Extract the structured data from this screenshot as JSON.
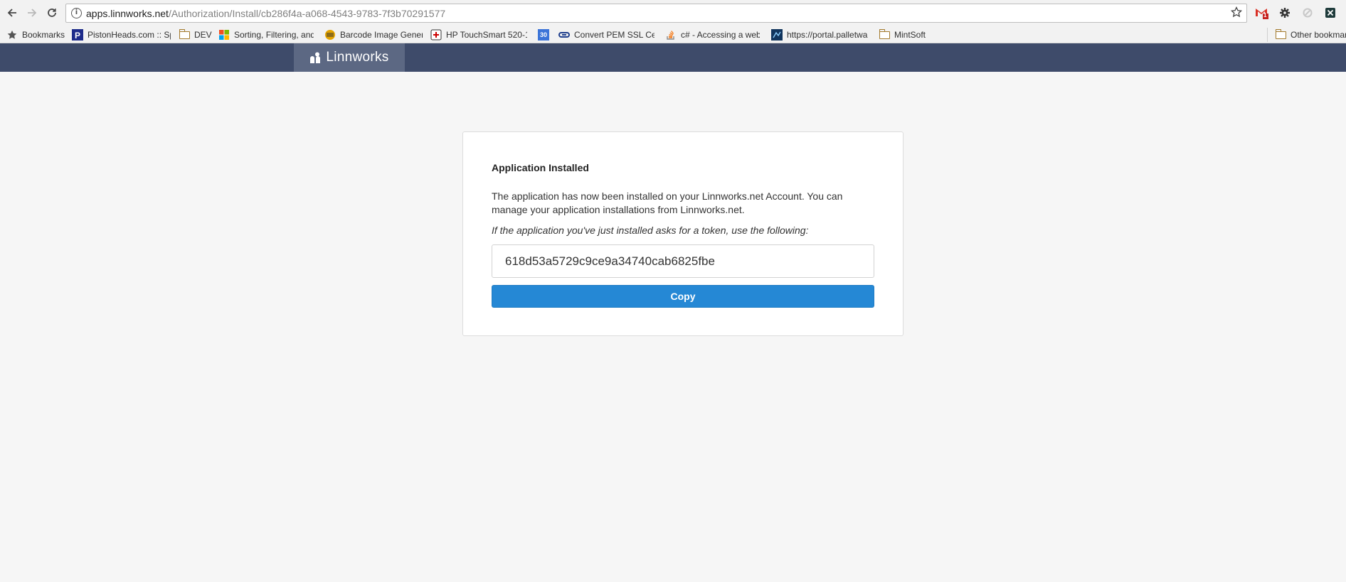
{
  "browser": {
    "url_host": "apps.linnworks.net",
    "url_path": "/Authorization/Install/cb286f4a-a068-4543-9783-7f3b70291577",
    "gmail_badge": "1",
    "bookmarks": [
      {
        "label": "Bookmarks",
        "icon": "star-icon"
      },
      {
        "label": "PistonHeads.com :: Sp",
        "icon": "pistonheads-favicon"
      },
      {
        "label": "DEV",
        "icon": "folder-icon"
      },
      {
        "label": "Sorting, Filtering, and",
        "icon": "microsoft-favicon"
      },
      {
        "label": "Barcode Image Gener",
        "icon": "barcode-favicon"
      },
      {
        "label": "HP TouchSmart 520-1",
        "icon": "hp-favicon"
      },
      {
        "label": "30",
        "icon": "calendar-favicon"
      },
      {
        "label": "Convert PEM SSL Cert",
        "icon": "ssl-favicon"
      },
      {
        "label": "c# - Accessing a web",
        "icon": "stackoverflow-favicon"
      },
      {
        "label": "https://portal.palletwa",
        "icon": "portal-favicon"
      },
      {
        "label": "MintSoft",
        "icon": "folder-icon"
      },
      {
        "label": "Other bookmarks",
        "icon": "folder-icon"
      }
    ]
  },
  "header": {
    "brand": "Linnworks"
  },
  "card": {
    "title": "Application Installed",
    "description": "The application has now been installed on your Linnworks.net Account. You can manage your application installations from Linnworks.net.",
    "hint": "If the application you've just installed asks for a token, use the following:",
    "token": "618d53a5729c9ce9a34740cab6825fbe",
    "copy_label": "Copy"
  },
  "colors": {
    "header_bg": "#3e4b6a",
    "brand_bg": "#5c6883",
    "button": "#2588d5"
  }
}
